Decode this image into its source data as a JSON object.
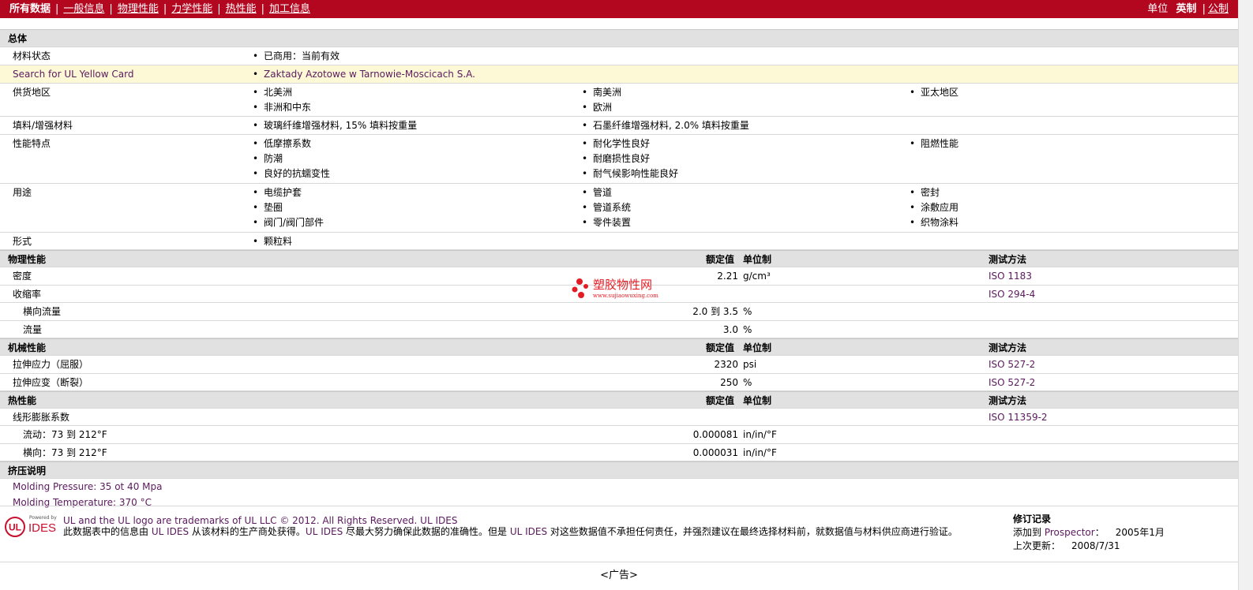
{
  "nav": {
    "items": [
      "所有数据",
      "一般信息",
      "物理性能",
      "力学性能",
      "热性能",
      "加工信息"
    ],
    "units_label": "单位",
    "unit_current": "英制",
    "unit_alt": "公制"
  },
  "general": {
    "title": "总体",
    "material_status": {
      "label": "材料状态",
      "value": "已商用：当前有效"
    },
    "ul_card": {
      "label": "Search for UL Yellow Card",
      "value": "Zaktady Azotowe w Tarnowie-Moscicach S.A."
    },
    "supply_region": {
      "label": "供货地区",
      "col1": [
        "北美洲",
        "非洲和中东"
      ],
      "col2": [
        "南美洲",
        "欧洲"
      ],
      "col3": [
        "亚太地区"
      ]
    },
    "filler": {
      "label": "填料/增强材料",
      "col1": "玻璃纤维增强材料, 15% 填料按重量",
      "col2": "石墨纤维增强材料, 2.0% 填料按重量",
      "col1_pct": "15%",
      "col2_pct": "2.0%"
    },
    "features": {
      "label": "性能特点",
      "col1": [
        "低摩擦系数",
        "防潮",
        "良好的抗蠕变性"
      ],
      "col2": [
        "耐化学性良好",
        "耐磨损性良好",
        "耐气候影响性能良好"
      ],
      "col3": [
        "阻燃性能"
      ]
    },
    "uses": {
      "label": "用途",
      "col1": [
        "电缆护套",
        "垫圈",
        "阀门/阀门部件"
      ],
      "col2": [
        "管道",
        "管道系统",
        "零件装置"
      ],
      "col3": [
        "密封",
        "涂敷应用",
        "织物涂料"
      ]
    },
    "form": {
      "label": "形式",
      "value": "颗粒料"
    }
  },
  "table_headers": {
    "rated": "额定值",
    "unit": "单位制",
    "method": "测试方法"
  },
  "physical": {
    "title": "物理性能",
    "rows": [
      {
        "label": "密度",
        "value": "2.21",
        "unit": "g/cm³",
        "method": "ISO 1183"
      },
      {
        "label": "收缩率",
        "value": "",
        "unit": "",
        "method": "ISO 294-4"
      },
      {
        "label": "横向流量",
        "value": "2.0 到  3.5",
        "unit": "%",
        "method": ""
      },
      {
        "label": "流量",
        "value": "3.0",
        "unit": "%",
        "method": ""
      }
    ]
  },
  "mechanical": {
    "title": "机械性能",
    "rows": [
      {
        "label": "拉伸应力（屈服）",
        "value": "2320",
        "unit": "psi",
        "method": "ISO 527-2"
      },
      {
        "label": "拉伸应变（断裂）",
        "value": "250",
        "unit": "%",
        "method": "ISO 527-2"
      }
    ]
  },
  "thermal": {
    "title": "热性能",
    "rows": [
      {
        "label": "线形膨胀系数",
        "value": "",
        "unit": "",
        "method": "ISO 11359-2"
      },
      {
        "label": "流动：73 到  212°F",
        "value": "0.000081",
        "unit": "in/in/°F",
        "method": ""
      },
      {
        "label": "横向：73 到  212°F",
        "value": "0.000031",
        "unit": "in/in/°F",
        "method": ""
      }
    ]
  },
  "extrusion": {
    "title": "挤压说明",
    "lines": [
      "Molding Pressure: 35 ot 40 Mpa",
      "Molding Temperature: 370 °C"
    ]
  },
  "watermark": {
    "name": "塑胶物性网",
    "url": "www.sujiaowuxing.com"
  },
  "footer": {
    "logo_small": "Powered by",
    "logo_text": "IDES",
    "trademark": "UL and the UL logo are trademarks of UL LLC © 2012. All Rights Reserved. ",
    "trademark_link": "UL IDES",
    "disclaimer_1": "此数据表中的信息由 ",
    "disclaimer_link1": "UL IDES",
    "disclaimer_2": " 从该材料的生产商处获得。",
    "disclaimer_link2": "UL IDES",
    "disclaimer_3": " 尽最大努力确保此数据的准确性。但是 ",
    "disclaimer_link3": "UL IDES",
    "disclaimer_4": " 对这些数据值不承担任何责任，并强烈建议在最终选择材料前，就数据值与材料供应商进行验证。",
    "revision_title": "修订记录",
    "added_label": "添加到 ",
    "added_link": "Prospector",
    "added_suffix": "：",
    "added_date": "2005年1月",
    "updated_label": "上次更新：",
    "updated_date": "2008/7/31"
  },
  "ad": "<广告>",
  "colors": {
    "topbar": "#b3061f",
    "section": "#e1e1e1",
    "highlight": "#fdf9d7",
    "link": "#5b1a5e"
  }
}
